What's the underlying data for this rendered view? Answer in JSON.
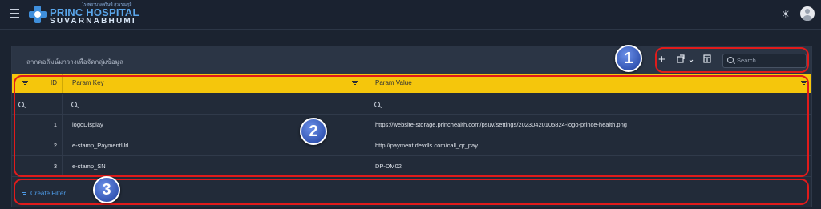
{
  "brand": {
    "thai_line": "โรงพยาบาลพรินซ์ สุวรรณภูมิ",
    "name_main": "PRINC HOSPITAL",
    "name_sub": "SUVARNABHUMI"
  },
  "toolbar": {
    "group_hint": "ลากคอลัมน์มาวางเพื่อจัดกลุ่มข้อมูล",
    "search_placeholder": "Search...",
    "icons": [
      "plus-icon",
      "export-icon",
      "chevron-down-icon",
      "column-chooser-icon",
      "search-icon"
    ]
  },
  "table": {
    "columns": [
      {
        "key": "id",
        "label": "ID"
      },
      {
        "key": "param_key",
        "label": "Param Key"
      },
      {
        "key": "param_value",
        "label": "Param Value"
      }
    ],
    "rows": [
      {
        "id": "1",
        "param_key": "logoDisplay",
        "param_value": "https://website-storage.princhealth.com/psuv/settings/20230420105824-logo-prince-health.png"
      },
      {
        "id": "2",
        "param_key": "e-stamp_PaymentUrl",
        "param_value": "http://payment.devdls.com/call_qr_pay"
      },
      {
        "id": "3",
        "param_key": "e-stamp_SN",
        "param_value": "DP-DM02"
      }
    ]
  },
  "footer": {
    "create_filter": "Create Filter"
  },
  "annotations": [
    "1",
    "2",
    "3"
  ],
  "colors": {
    "header_bg": "#f5c60c",
    "accent_blue": "#4d9be8",
    "annotation_red": "#e01b1b"
  }
}
